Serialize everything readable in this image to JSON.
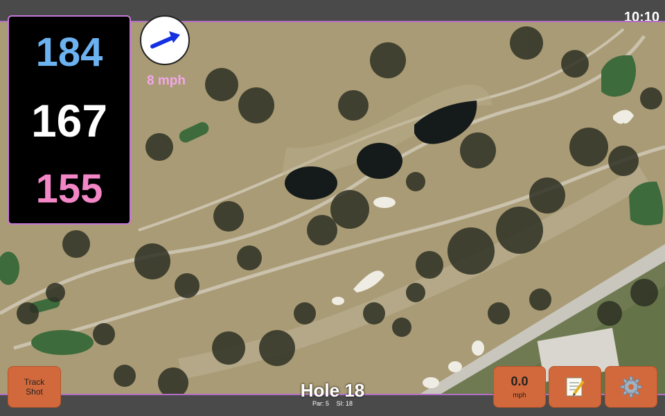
{
  "status": {
    "time": "10:10"
  },
  "distances": {
    "back": "184",
    "middle": "167",
    "front": "155"
  },
  "wind": {
    "direction_icon": "arrow-right-icon",
    "speed": "8 mph"
  },
  "map": {
    "description_icon": "satellite-course-map"
  },
  "hole": {
    "title": "Hole 18",
    "par": "Par: 5",
    "stroke_index": "SI: 18"
  },
  "buttons": {
    "track_shot_line1": "Track",
    "track_shot_line2": "Shot",
    "speed_value": "0.0",
    "speed_unit": "mph",
    "notes_icon": "notepad-icon",
    "settings_icon": "gear-icon"
  },
  "colors": {
    "accent": "#b46ec8",
    "button": "#d2693c",
    "back_yardage": "#6cb2f0",
    "front_yardage": "#f286c6"
  }
}
